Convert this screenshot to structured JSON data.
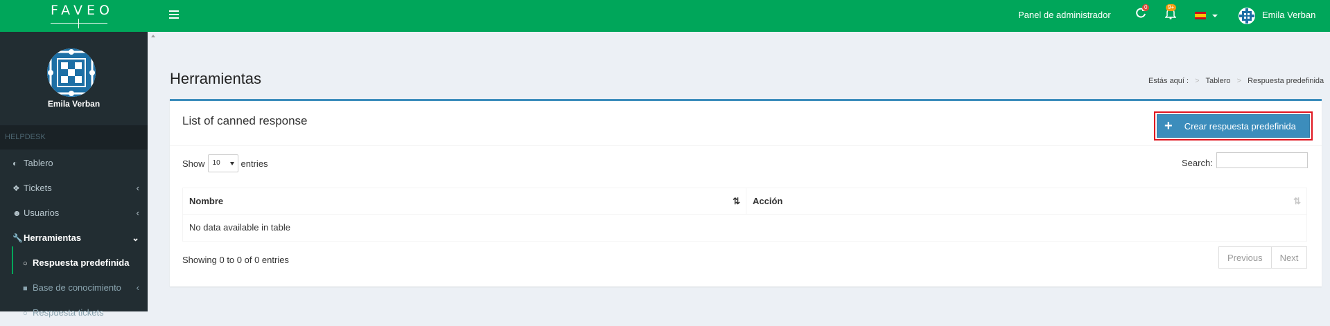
{
  "brand": {
    "logo_text": "FAVEO"
  },
  "topbar": {
    "admin_panel": "Panel de administrador",
    "refresh_badge": "0",
    "bell_badge": "9+",
    "user_name": "Emila Verban"
  },
  "sidebar": {
    "user_name": "Emila Verban",
    "section_header": "HELPDESK",
    "items": [
      {
        "label": "Tablero",
        "icon": "dashboard-icon"
      },
      {
        "label": "Tickets",
        "icon": "ticket-icon"
      },
      {
        "label": "Usuarios",
        "icon": "users-icon"
      },
      {
        "label": "Herramientas",
        "icon": "wrench-icon"
      }
    ],
    "subitems": [
      {
        "label": "Respuesta predefinida",
        "icon": "circle-icon"
      },
      {
        "label": "Base de conocimiento",
        "icon": "book-icon"
      },
      {
        "label": "Respuesta tickets",
        "icon": "circle-icon"
      }
    ]
  },
  "page": {
    "title": "Herramientas",
    "breadcrumb": {
      "prefix": "Estás aquí :",
      "items": [
        "Tablero",
        "Respuesta predefinida"
      ]
    }
  },
  "box": {
    "title": "List of canned response",
    "create_button": "Crear respuesta predefinida",
    "show_label": "Show",
    "entries_value": "10",
    "entries_label": "entries",
    "search_label": "Search:",
    "columns": [
      "Nombre",
      "Acción"
    ],
    "empty_message": "No data available in table",
    "info": "Showing 0 to 0 of 0 entries",
    "pagination": {
      "previous": "Previous",
      "next": "Next"
    }
  },
  "colors": {
    "topbar": "#00a65a",
    "sidebar": "#222d32",
    "primary_button": "#3c8dbc",
    "highlight_border": "#e0141e"
  }
}
